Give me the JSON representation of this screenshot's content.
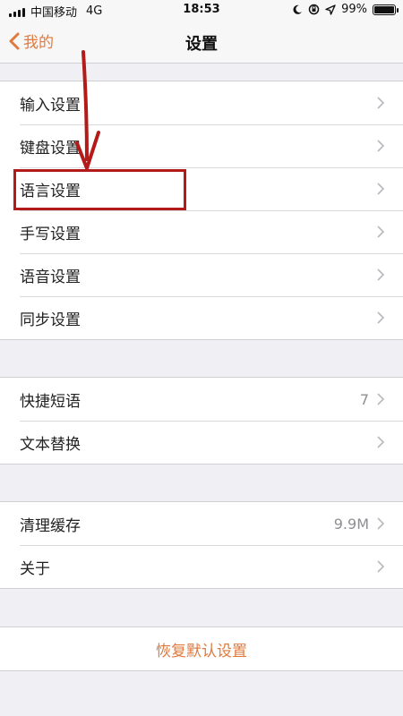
{
  "status_bar": {
    "carrier": "中国移动",
    "network": "4G",
    "time": "18:53",
    "battery": "99%",
    "battery_level": 0.99,
    "icons": [
      "signal-bars-icon",
      "moon-icon",
      "orientation-lock-icon",
      "location-arrow-icon",
      "battery-icon"
    ]
  },
  "nav": {
    "back_label": "我的",
    "title": "设置"
  },
  "groups": [
    {
      "items": [
        {
          "label": "输入设置"
        },
        {
          "label": "键盘设置"
        },
        {
          "label": "语言设置"
        },
        {
          "label": "手写设置"
        },
        {
          "label": "语音设置"
        },
        {
          "label": "同步设置"
        }
      ]
    },
    {
      "items": [
        {
          "label": "快捷短语",
          "value": "7"
        },
        {
          "label": "文本替换"
        }
      ]
    },
    {
      "items": [
        {
          "label": "清理缓存",
          "value": "9.9M"
        },
        {
          "label": "关于"
        }
      ]
    }
  ],
  "reset_label": "恢复默认设置",
  "colors": {
    "accent": "#e07a3e",
    "annotation": "#b31a1a",
    "background": "#efeff4"
  }
}
